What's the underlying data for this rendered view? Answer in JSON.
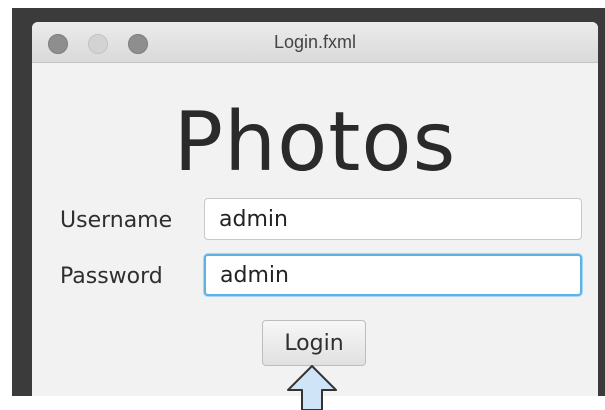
{
  "window": {
    "title": "Login.fxml",
    "buttons": [
      "close",
      "minimize",
      "zoom"
    ]
  },
  "app": {
    "title": "Photos"
  },
  "form": {
    "username_label": "Username",
    "username_value": "admin",
    "password_label": "Password",
    "password_value": "admin",
    "focused_field": "password",
    "login_label": "Login"
  },
  "colors": {
    "focus_ring": "#5fb0e6",
    "arrow_fill": "#cfe4f7",
    "arrow_stroke": "#333333"
  },
  "icons": {
    "annotation": "up-arrow-icon"
  }
}
